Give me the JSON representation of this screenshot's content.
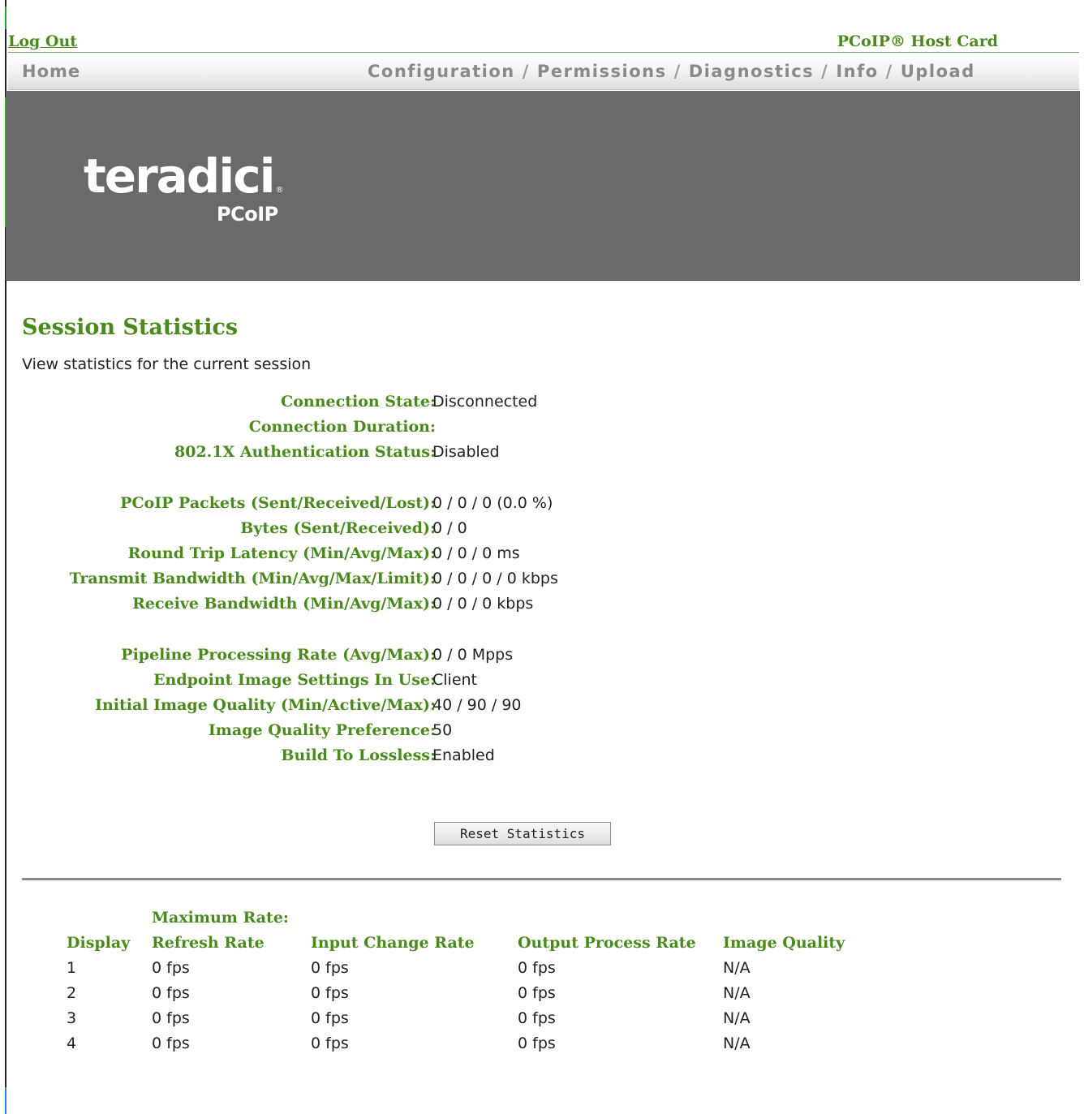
{
  "header": {
    "logout_label": "Log Out",
    "product_label": "PCoIP® Host Card"
  },
  "nav": {
    "home": "Home",
    "items": [
      "Configuration",
      "Permissions",
      "Diagnostics",
      "Info",
      "Upload"
    ],
    "separator": "/"
  },
  "logo": {
    "word": "teradici",
    "registered": "®",
    "sub": "PCoIP"
  },
  "page": {
    "title": "Session Statistics",
    "description": "View statistics for the current session"
  },
  "stats": {
    "connection_state": {
      "label": "Connection State:",
      "value": "Disconnected"
    },
    "connection_duration": {
      "label": "Connection Duration:",
      "value": ""
    },
    "auth_status": {
      "label": "802.1X Authentication Status:",
      "value": "Disabled"
    },
    "packets": {
      "label": "PCoIP Packets (Sent/Received/Lost):",
      "value": "0 / 0 / 0 (0.0 %)"
    },
    "bytes": {
      "label": "Bytes (Sent/Received):",
      "value": "0 / 0"
    },
    "latency": {
      "label": "Round Trip Latency (Min/Avg/Max):",
      "value": "0 / 0 / 0 ms"
    },
    "tx_bandwidth": {
      "label": "Transmit Bandwidth (Min/Avg/Max/Limit):",
      "value": "0 / 0 / 0 / 0 kbps"
    },
    "rx_bandwidth": {
      "label": "Receive Bandwidth (Min/Avg/Max):",
      "value": "0 / 0 / 0 kbps"
    },
    "pipeline_rate": {
      "label": "Pipeline Processing Rate (Avg/Max):",
      "value": "0 / 0 Mpps"
    },
    "endpoint_settings": {
      "label": "Endpoint Image Settings In Use:",
      "value": "Client"
    },
    "initial_quality": {
      "label": "Initial Image Quality (Min/Active/Max):",
      "value": "40 / 90 / 90"
    },
    "quality_pref": {
      "label": "Image Quality Preference:",
      "value": "50"
    },
    "build_lossless": {
      "label": "Build To Lossless:",
      "value": "Enabled"
    }
  },
  "reset_button": "Reset Statistics",
  "display_table": {
    "headers": {
      "display": "Display",
      "refresh_top": "Maximum Rate:",
      "refresh": "Refresh Rate",
      "input": "Input Change Rate",
      "output": "Output Process Rate",
      "quality": "Image Quality"
    },
    "rows": [
      [
        "1",
        "0 fps",
        "0 fps",
        "0 fps",
        "N/A"
      ],
      [
        "2",
        "0 fps",
        "0 fps",
        "0 fps",
        "N/A"
      ],
      [
        "3",
        "0 fps",
        "0 fps",
        "0 fps",
        "N/A"
      ],
      [
        "4",
        "0 fps",
        "0 fps",
        "0 fps",
        "N/A"
      ]
    ]
  }
}
